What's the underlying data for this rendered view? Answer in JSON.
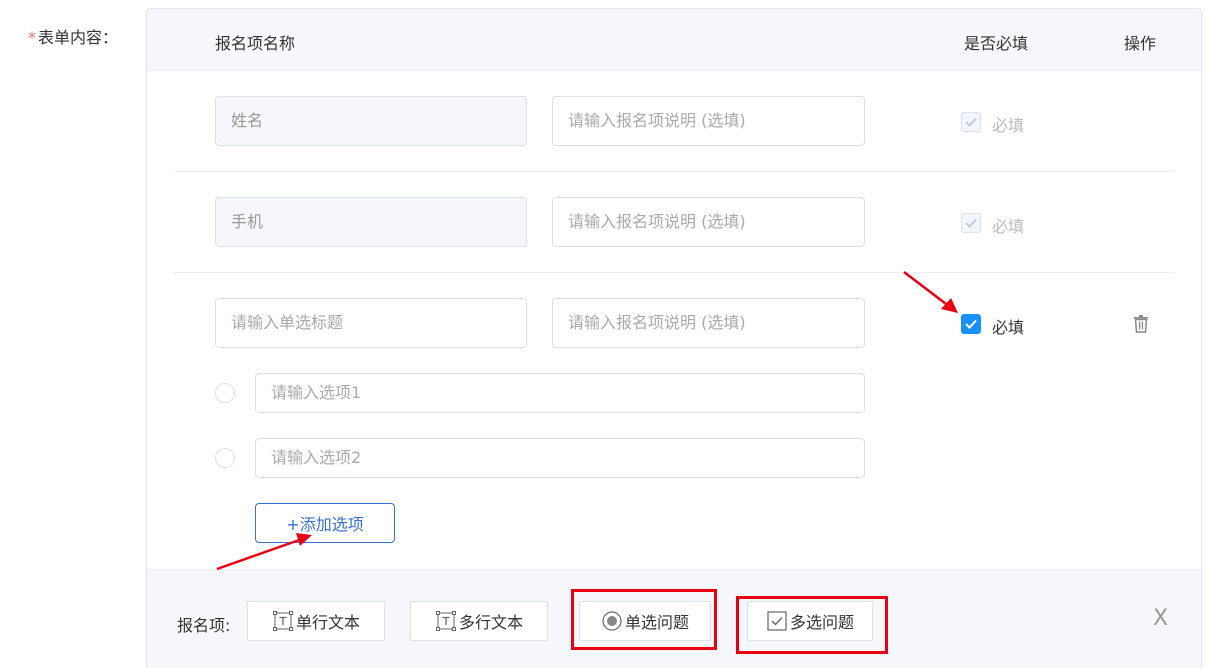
{
  "form": {
    "required_mark": "*",
    "label": "表单内容："
  },
  "header": {
    "name": "报名项名称",
    "required": "是否必填",
    "operation": "操作"
  },
  "rows": [
    {
      "title_value": "姓名",
      "desc_placeholder": "请输入报名项说明 (选填)",
      "required_label": "必填",
      "checked": true,
      "disabled": true
    },
    {
      "title_value": "手机",
      "desc_placeholder": "请输入报名项说明 (选填)",
      "required_label": "必填",
      "checked": true,
      "disabled": true
    },
    {
      "title_placeholder": "请输入单选标题",
      "desc_placeholder": "请输入报名项说明 (选填)",
      "required_label": "必填",
      "checked": true,
      "disabled": false,
      "options": [
        {
          "placeholder": "请输入选项1"
        },
        {
          "placeholder": "请输入选项2"
        }
      ],
      "add_option_label": "+添加选项"
    }
  ],
  "toolbar": {
    "label": "报名项:",
    "buttons": [
      {
        "label": "单行文本",
        "icon": "text-field-icon"
      },
      {
        "label": "多行文本",
        "icon": "text-field-icon"
      },
      {
        "label": "单选问题",
        "icon": "radio-icon"
      },
      {
        "label": "多选问题",
        "icon": "checkbox-icon"
      }
    ],
    "close_label": "X"
  },
  "colors": {
    "primary": "#1890ff",
    "link": "#3a6fd8",
    "annotation": "#e60012",
    "required": "#f56c6c"
  }
}
